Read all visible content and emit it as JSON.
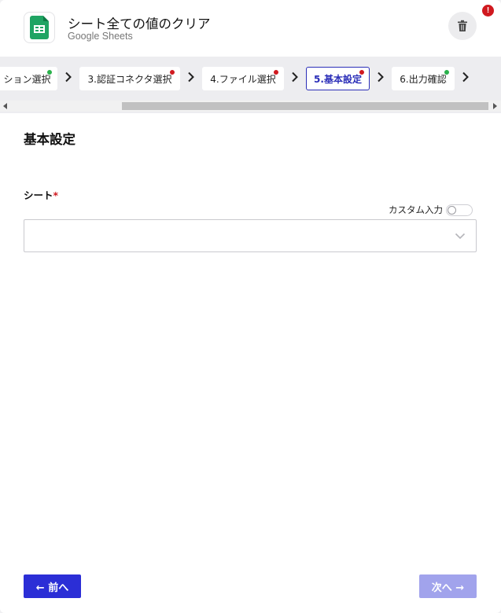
{
  "header": {
    "title": "シート全ての値のクリア",
    "subtitle": "Google Sheets",
    "app_icon": "google-sheets-icon",
    "delete_icon": "trash-icon",
    "error_badge": "!"
  },
  "steps": [
    {
      "label": "アクション選択",
      "status": "ok",
      "active": false
    },
    {
      "label": "3.認証コネクタ選択",
      "status": "error",
      "active": false
    },
    {
      "label": "4.ファイル選択",
      "status": "error",
      "active": false
    },
    {
      "label": "5.基本設定",
      "status": "error",
      "active": true
    },
    {
      "label": "6.出力確認",
      "status": "ok",
      "active": false
    }
  ],
  "visible_step_text": [
    "ション選択",
    "3.認証コネクタ選択",
    "4.ファイル選択",
    "5.基本設定",
    "6.出力確認"
  ],
  "main": {
    "section_title": "基本設定",
    "sheet_label": "シート",
    "required_mark": "*",
    "custom_input_label": "カスタム入力",
    "custom_input_enabled": false,
    "sheet_value": ""
  },
  "footer": {
    "prev_label": "← 前へ",
    "next_label": "次へ →"
  },
  "colors": {
    "accent": "#2b2ed6",
    "accent_disabled": "#a1a3ec",
    "ok": "#2bb24c",
    "error": "#d0191f"
  }
}
